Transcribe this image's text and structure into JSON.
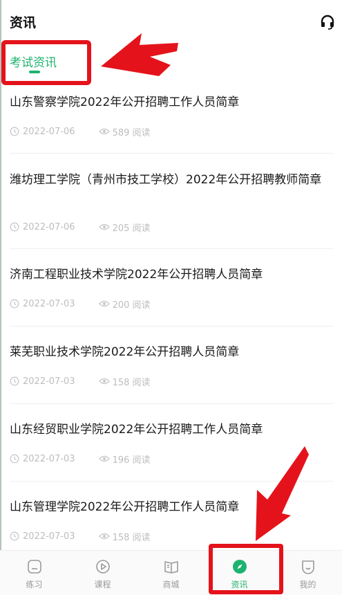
{
  "header": {
    "title": "资讯",
    "support_icon": "headset-icon"
  },
  "tabs": [
    {
      "label": "考试资讯",
      "active": true
    }
  ],
  "articles": [
    {
      "title": "山东警察学院2022年公开招聘工作人员简章",
      "date": "2022-07-06",
      "views": "589 阅读"
    },
    {
      "title": "潍坊理工学院（青州市技工学校）2022年公开招聘教师简章",
      "date": "2022-07-06",
      "views": "205 阅读"
    },
    {
      "title": "济南工程职业技术学院2022年公开招聘人员简章",
      "date": "2022-07-03",
      "views": "200 阅读"
    },
    {
      "title": "莱芜职业技术学院2022年公开招聘人员简章",
      "date": "2022-07-03",
      "views": "158 阅读"
    },
    {
      "title": "山东经贸职业学院2022年公开招聘工作人员简章",
      "date": "2022-07-03",
      "views": "196 阅读"
    },
    {
      "title": "山东管理学院2022年公开招聘工作人员简章",
      "date": "2022-07-03",
      "views": "158 阅读"
    }
  ],
  "bottom_nav": [
    {
      "label": "练习",
      "icon": "practice-icon",
      "active": false
    },
    {
      "label": "课程",
      "icon": "play-icon",
      "active": false
    },
    {
      "label": "商城",
      "icon": "book-icon",
      "active": false
    },
    {
      "label": "资讯",
      "icon": "compass-icon",
      "active": true
    },
    {
      "label": "我的",
      "icon": "profile-icon",
      "active": false
    }
  ],
  "colors": {
    "accent": "#1db36f",
    "annotation_red": "#e4131b",
    "meta_gray": "#bdbdbd"
  }
}
